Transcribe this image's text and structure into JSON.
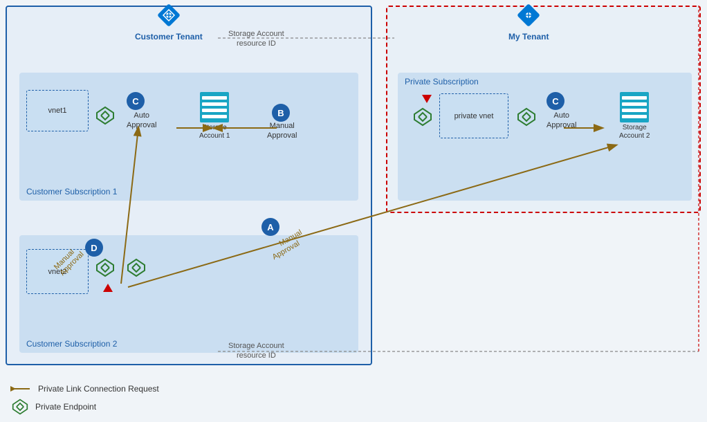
{
  "tenants": {
    "customer": {
      "label": "Customer Tenant",
      "sub1_label": "Customer Subscription 1",
      "sub2_label": "Customer Subscription 2"
    },
    "my": {
      "label": "My Tenant",
      "private_sub_label": "Private Subscription"
    }
  },
  "vnets": {
    "vnet1": "vnet1",
    "vnet2": "vnet2",
    "private_vnet": "private vnet"
  },
  "storage": {
    "account1": {
      "label": "Storage\nAccount 1"
    },
    "account2": {
      "label": "Storage\nAccount 2"
    }
  },
  "badges": {
    "A": "A",
    "B": "B",
    "C1": "C",
    "C2": "C",
    "D": "D"
  },
  "approvals": {
    "manual_A": "Manual\nApproval",
    "manual_B": "Manual\nApproval",
    "manual_D": "Manual\nApproval",
    "auto1": "Auto\nApproval",
    "auto2": "Auto\nApproval"
  },
  "resource_id_top": "Storage Account\nresource ID",
  "resource_id_bottom": "Storage Account\nresource ID",
  "legend": {
    "arrow_label": "Private Link Connection Request",
    "pe_label": "Private Endpoint"
  }
}
